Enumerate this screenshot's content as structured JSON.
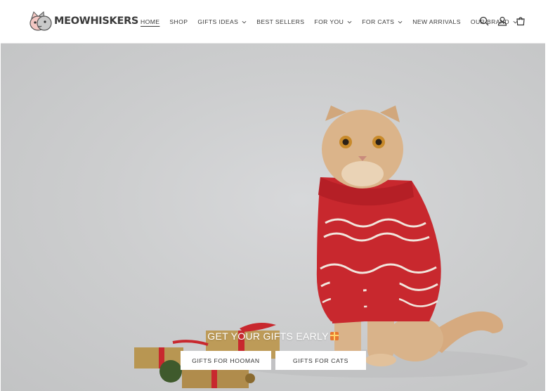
{
  "brand": {
    "name": "MEOWHISKERS",
    "logo_icon": "cat-head-logo"
  },
  "nav": {
    "items": [
      {
        "label": "HOME",
        "active": true,
        "dropdown": false
      },
      {
        "label": "SHOP",
        "active": false,
        "dropdown": false
      },
      {
        "label": "GIFTS IDEAS",
        "active": false,
        "dropdown": true
      },
      {
        "label": "BEST SELLERS",
        "active": false,
        "dropdown": false
      },
      {
        "label": "FOR YOU",
        "active": false,
        "dropdown": true
      },
      {
        "label": "FOR CATS",
        "active": false,
        "dropdown": true
      },
      {
        "label": "NEW ARRIVALS",
        "active": false,
        "dropdown": false
      },
      {
        "label": "OUR BRAND",
        "active": false,
        "dropdown": true
      }
    ]
  },
  "header_icons": [
    "search-icon",
    "account-icon",
    "cart-icon"
  ],
  "hero": {
    "image": "cat-in-red-christmas-sweater-with-gifts",
    "heading": "GET YOUR GIFTS EARLY",
    "heading_emoji": "gift-emoji",
    "buttons": [
      {
        "label": "GIFTS FOR HOOMAN"
      },
      {
        "label": "GIFTS FOR CATS"
      }
    ]
  },
  "colors": {
    "hero_bg": "#cdcecf",
    "sweater_red": "#c8282e",
    "cat_fur": "#d9b38a",
    "text_dark": "#3a3a3a"
  }
}
